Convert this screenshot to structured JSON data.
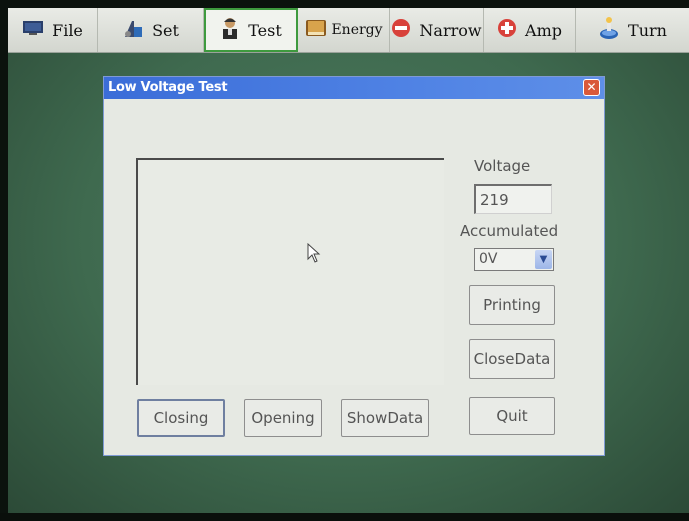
{
  "menubar": {
    "items": [
      {
        "label": "File",
        "icon": "monitor-icon"
      },
      {
        "label": "Set",
        "icon": "settings-icon"
      },
      {
        "label": "Test",
        "icon": "person-icon",
        "active": true
      },
      {
        "label": "Energy",
        "icon": "book-icon"
      },
      {
        "label": "Narrow",
        "icon": "minus-circle-icon"
      },
      {
        "label": "Amp",
        "icon": "plus-circle-icon"
      },
      {
        "label": "Turn",
        "icon": "turn-icon"
      }
    ]
  },
  "dialog": {
    "title": "Low Voltage Test",
    "close_glyph": "✕",
    "voltage_label": "Voltage",
    "voltage_value": "219",
    "accumulated_label": "Accumulated",
    "accumulated_value": "0V",
    "buttons": {
      "printing": "Printing",
      "close_data": "CloseData",
      "closing": "Closing",
      "opening": "Opening",
      "show_data": "ShowData",
      "quit": "Quit"
    }
  },
  "colors": {
    "titlebar": "#3b6dd8",
    "desktop": "#3f6a4f",
    "active_tab_border": "#3e9a3e",
    "close_button": "#d9593a"
  }
}
